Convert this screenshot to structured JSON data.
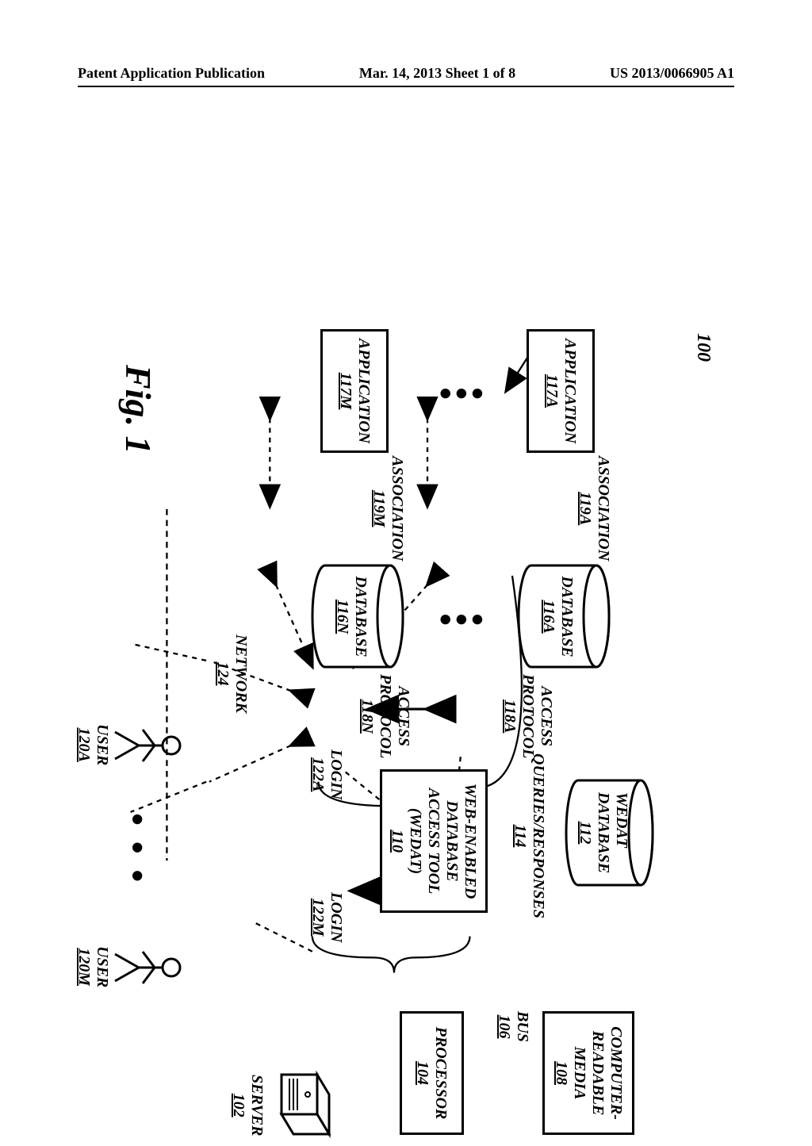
{
  "header": {
    "left": "Patent Application Publication",
    "center": "Mar. 14, 2013  Sheet 1 of 8",
    "right": "US 2013/0066905 A1"
  },
  "fig": {
    "ref100": "100",
    "figlabel": "Fig. 1",
    "app_a": {
      "title": "APPLICATION",
      "ref": "117A"
    },
    "app_m": {
      "title": "APPLICATION",
      "ref": "117M"
    },
    "assoc_a": {
      "title": "ASSOCIATION",
      "ref": "119A"
    },
    "assoc_m": {
      "title": "ASSOCIATION",
      "ref": "119M"
    },
    "db_a": {
      "title": "DATABASE",
      "ref": "116A"
    },
    "db_n": {
      "title": "DATABASE",
      "ref": "116N"
    },
    "access_a": {
      "title": "ACCESS\nPROTOCOL",
      "ref": "118A"
    },
    "access_n": {
      "title": "ACCESS\nPROTOCOL",
      "ref": "118N"
    },
    "wedat_db": {
      "title": "WEDAT\nDATABASE",
      "ref": "112"
    },
    "qr": {
      "title": "QUERIES/RESPONSES",
      "ref": "114"
    },
    "wedat": {
      "title": "WEB-ENABLED\nDATABASE\nACCESS TOOL\n(WEDAT)",
      "ref": "110"
    },
    "login_a": {
      "title": "LOGIN",
      "ref": "122A"
    },
    "login_m": {
      "title": "LOGIN",
      "ref": "122M"
    },
    "network": {
      "title": "NETWORK",
      "ref": "124"
    },
    "user_a": {
      "title": "USER",
      "ref": "120A"
    },
    "user_m": {
      "title": "USER",
      "ref": "120M"
    },
    "crm": {
      "title": "COMPUTER-\nREADABLE\nMEDIA",
      "ref": "108"
    },
    "bus": {
      "title": "BUS",
      "ref": "106"
    },
    "proc": {
      "title": "PROCESSOR",
      "ref": "104"
    },
    "server": {
      "title": "SERVER",
      "ref": "102"
    }
  }
}
